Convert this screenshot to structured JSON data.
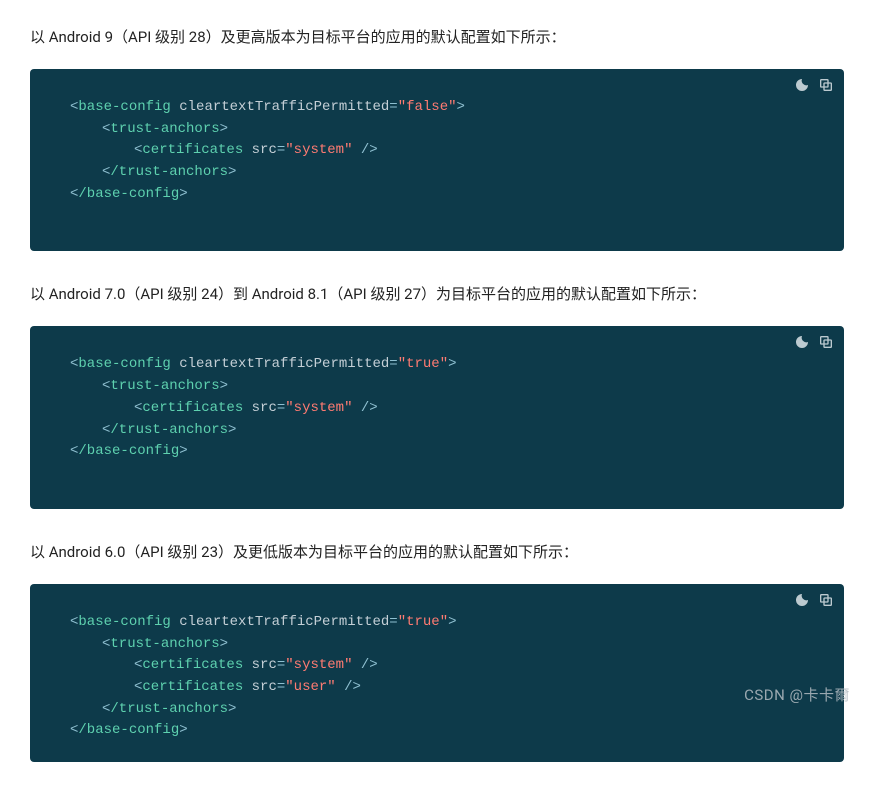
{
  "sections": [
    {
      "caption": "以 Android 9（API 级别 28）及更高版本为目标平台的应用的默认配置如下所示：",
      "code": {
        "tag_base_open": "base-config",
        "attr_name": "cleartextTrafficPermitted",
        "attr_val": "\"false\"",
        "tag_trust_open": "trust-anchors",
        "tag_cert": "certificates",
        "cert_attr": "src",
        "cert_val1": "\"system\"",
        "tag_trust_close": "/trust-anchors",
        "tag_base_close": "/base-config"
      }
    },
    {
      "caption": "以 Android 7.0（API 级别 24）到 Android 8.1（API 级别 27）为目标平台的应用的默认配置如下所示：",
      "code": {
        "tag_base_open": "base-config",
        "attr_name": "cleartextTrafficPermitted",
        "attr_val": "\"true\"",
        "tag_trust_open": "trust-anchors",
        "tag_cert": "certificates",
        "cert_attr": "src",
        "cert_val1": "\"system\"",
        "tag_trust_close": "/trust-anchors",
        "tag_base_close": "/base-config"
      }
    },
    {
      "caption": "以 Android 6.0（API 级别 23）及更低版本为目标平台的应用的默认配置如下所示：",
      "code": {
        "tag_base_open": "base-config",
        "attr_name": "cleartextTrafficPermitted",
        "attr_val": "\"true\"",
        "tag_trust_open": "trust-anchors",
        "tag_cert": "certificates",
        "cert_attr": "src",
        "cert_val1": "\"system\"",
        "cert_val2": "\"user\"",
        "tag_trust_close": "/trust-anchors",
        "tag_base_close": "/base-config"
      }
    }
  ],
  "punc": {
    "lt": "<",
    "gt": ">",
    "sgt": " />",
    "eq": "="
  },
  "sp": " ",
  "watermark": "CSDN @卡卡爾"
}
